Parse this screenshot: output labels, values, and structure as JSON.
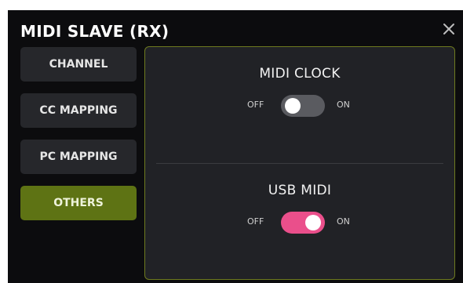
{
  "dialog": {
    "title": "MIDI SLAVE (RX)",
    "close_icon": "close-icon"
  },
  "sidebar": {
    "items": [
      {
        "label": "CHANNEL",
        "active": false
      },
      {
        "label": "CC MAPPING",
        "active": false
      },
      {
        "label": "PC MAPPING",
        "active": false
      },
      {
        "label": "OTHERS",
        "active": true
      }
    ]
  },
  "settings": {
    "midi_clock": {
      "title": "MIDI CLOCK",
      "off_label": "OFF",
      "on_label": "ON",
      "enabled": false
    },
    "usb_midi": {
      "title": "USB MIDI",
      "off_label": "OFF",
      "on_label": "ON",
      "enabled": true
    }
  },
  "colors": {
    "background": "#0c0c0e",
    "panel": "#212226",
    "panel_border": "#6e7a1f",
    "nav_item": "#26272b",
    "nav_active": "#5e7314",
    "toggle_on": "#ea4f8b",
    "toggle_off": "#5a5b60"
  }
}
